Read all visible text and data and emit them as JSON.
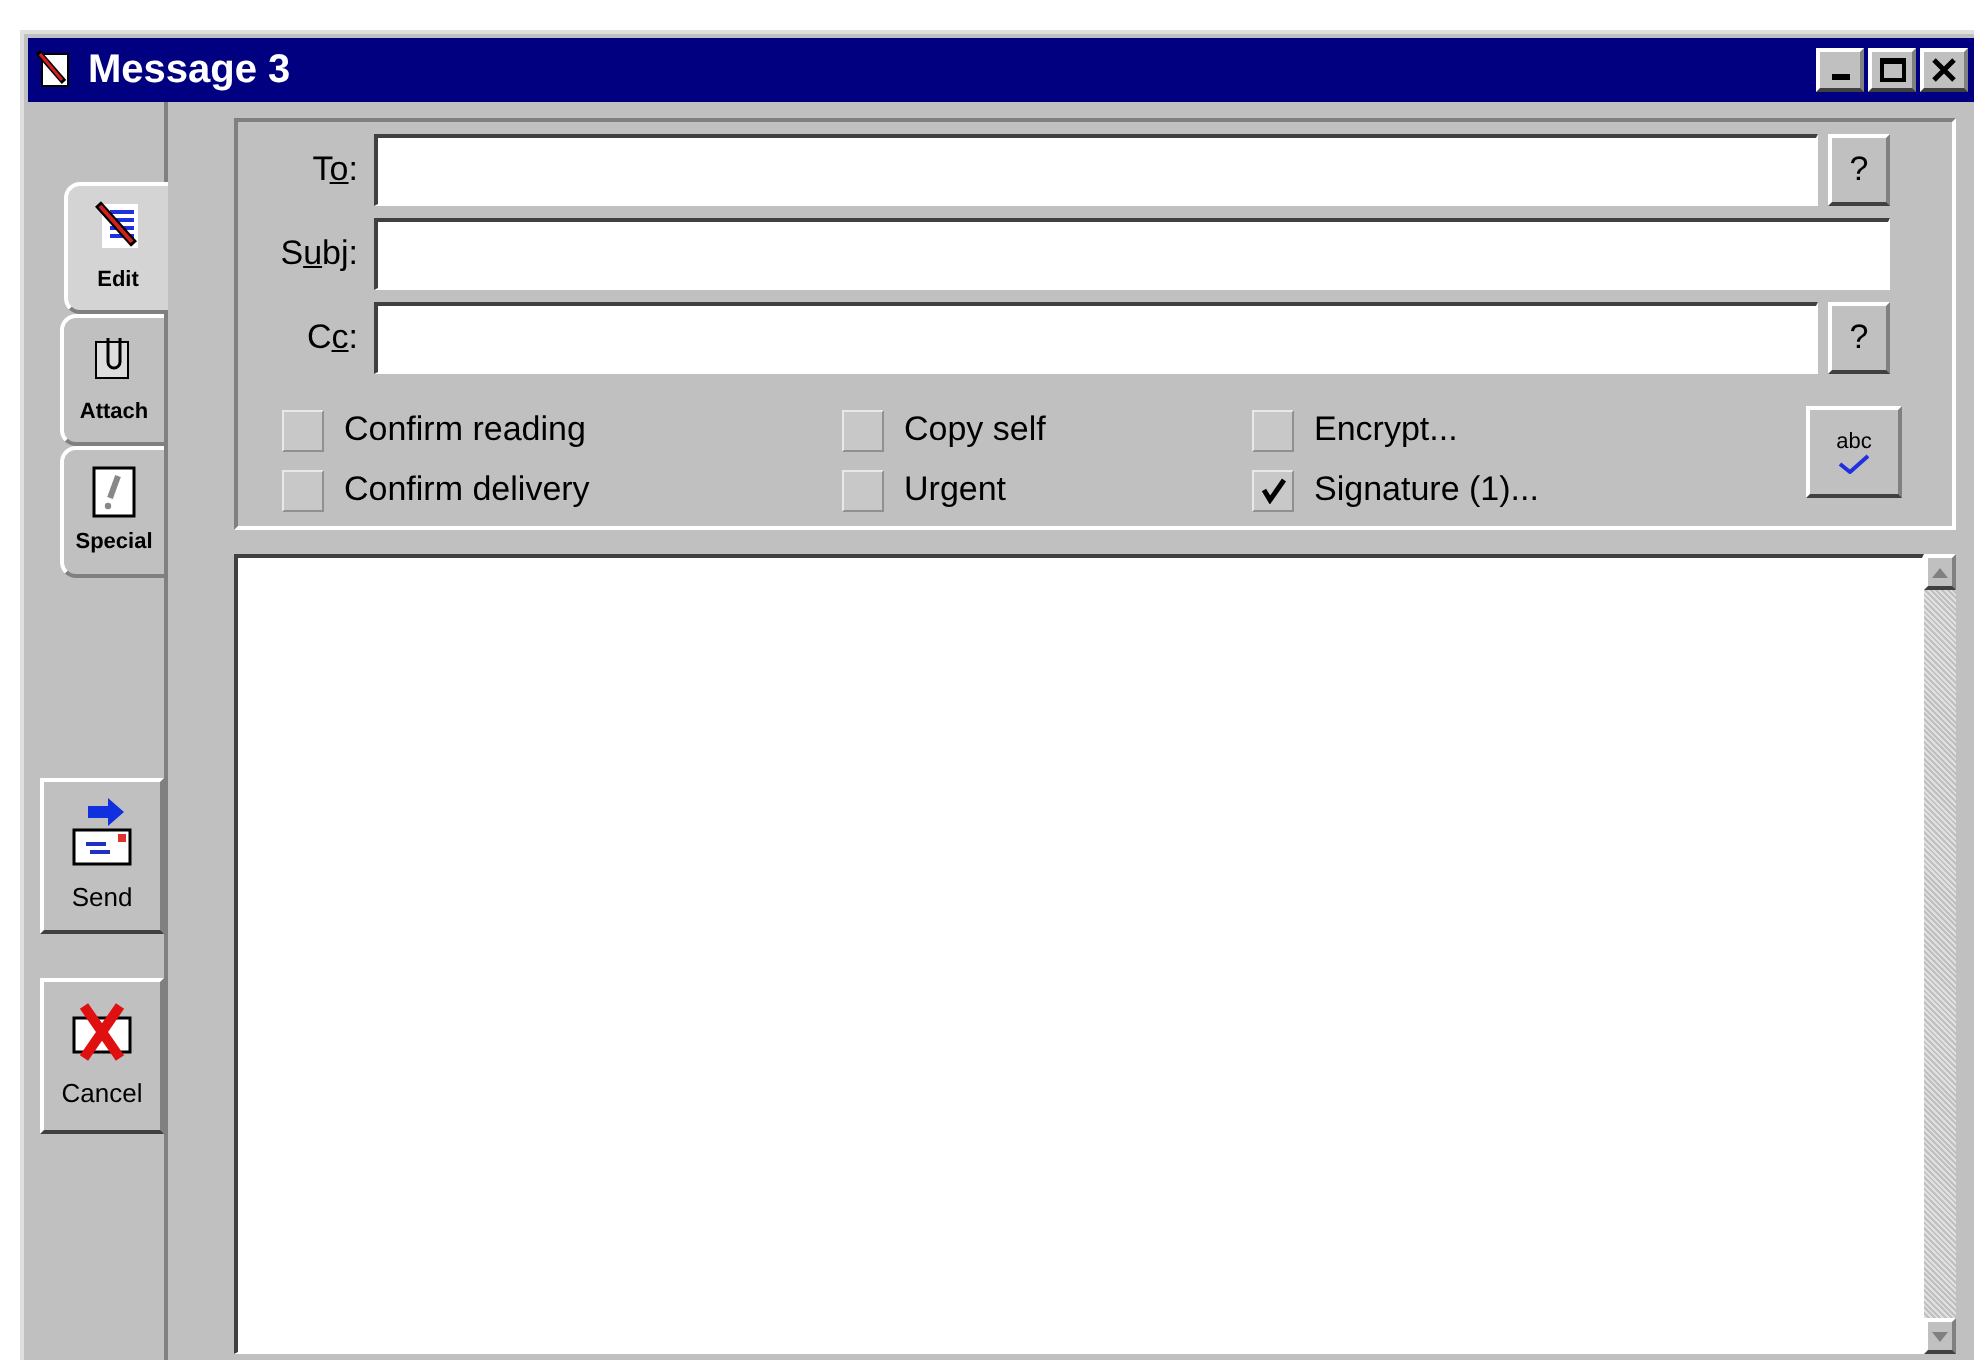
{
  "window": {
    "title": "Message 3"
  },
  "tabs": [
    {
      "label": "Edit",
      "kind": "edit",
      "selected": true
    },
    {
      "label": "Attach",
      "kind": "attach",
      "selected": false
    },
    {
      "label": "Special",
      "kind": "special",
      "selected": false
    }
  ],
  "actions": [
    {
      "label": "Send",
      "kind": "send"
    },
    {
      "label": "Cancel",
      "kind": "cancel"
    }
  ],
  "fields": [
    {
      "label_start": "T",
      "accesskey": "o",
      "label_end": ":",
      "help_button": "?"
    },
    {
      "label_start": "S",
      "accesskey": "u",
      "label_end": "bj:"
    },
    {
      "label_start": "C",
      "accesskey": "c",
      "label_end": ":",
      "help_button": "?"
    }
  ],
  "options": [
    {
      "label": "Confirm reading",
      "checked": false
    },
    {
      "label": "Confirm delivery",
      "checked": false
    },
    {
      "label": "Copy self",
      "checked": false
    },
    {
      "label": "Urgent",
      "checked": false
    },
    {
      "label": "Encrypt...",
      "checked": false
    },
    {
      "label": "Signature (1)...",
      "checked": true
    }
  ],
  "spell_button": {
    "label": "abc"
  }
}
